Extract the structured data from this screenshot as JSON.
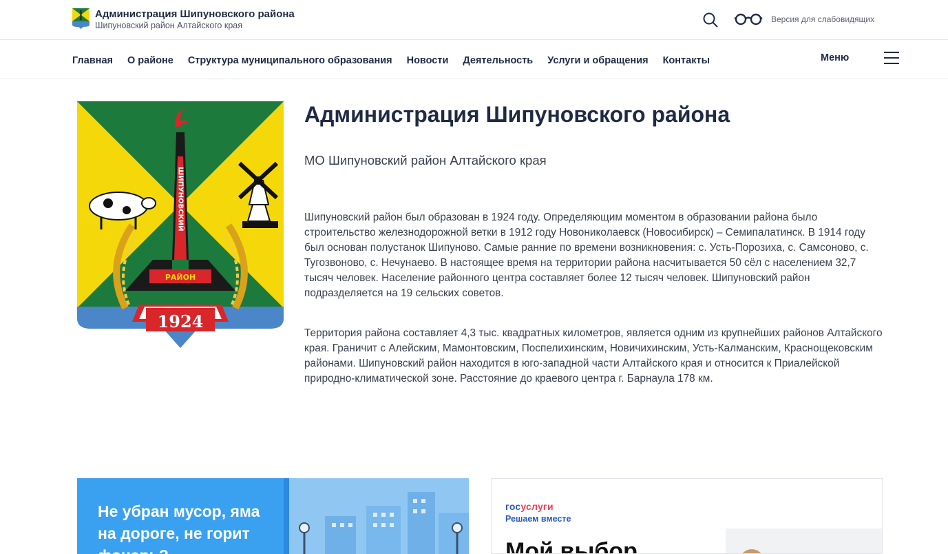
{
  "header": {
    "title": "Администрация Шипуновского района",
    "subtitle": "Шипуновский район Алтайского края",
    "search_icon": "search-icon",
    "accessibility_icon": "glasses-icon",
    "accessibility_label": "Версия для слабовидящих"
  },
  "nav": {
    "items": [
      {
        "label": "Главная"
      },
      {
        "label": "О районе"
      },
      {
        "label": "Структура муниципального образования"
      },
      {
        "label": "Новости"
      },
      {
        "label": "Деятельность"
      },
      {
        "label": "Услуги и обращения"
      },
      {
        "label": "Контакты"
      }
    ],
    "menu_label": "Меню",
    "menu_icon": "hamburger-icon"
  },
  "main": {
    "title": "Администрация Шипуновского района",
    "subtitle": "МО Шипуновский район Алтайского края",
    "paragraphs": [
      "Шипуновский район был образован в 1924 году. Определяющим моментом в образовании района было строительство железнодорожной ветки в 1912 году Новониколаевск (Новосибирск) – Семипалатинск. В 1914 году был основан полустанок Шипуново. Самые ранние по времени возникновения: с. Усть-Порозиха, с. Самсоново, с. Тугозвоново, с. Нечунаево. В настоящее время на территории района насчитывается 50 сёл с населением 32,7 тысяч человек. Население районного центра составляет более 12 тысяч человек. Шипуновский район подразделяется на 19 сельских советов.",
      "Территория района составляет 4,3 тыс. квадратных километров, является одним из крупнейших районов Алтайского края. Граничит с Алейским, Мамонтовским, Поспелихинским, Новичихинским, Усть-Калманским, Краснощековским районами. Шипуновский район находится в юго-западной части Алтайского края и относится к Приалейской природно-климатической зоне. Расстояние до краевого центра г. Барнаула 178 км."
    ],
    "coat": {
      "tower_text": "ШИПУНОВСКИЙ",
      "band_text": "РАЙОН",
      "year": "1924",
      "colors": {
        "green": "#1c7a3c",
        "yellow": "#f5d80a",
        "blue": "#4a86c8",
        "red": "#d8262b"
      }
    }
  },
  "banners": {
    "left": {
      "text": "Не убран мусор, яма на дороге, не горит фонарь?"
    },
    "right": {
      "logo_part1": "гос",
      "logo_part2": "услуги",
      "sub": "Решаем вместе",
      "big": "Мой выбор"
    }
  }
}
